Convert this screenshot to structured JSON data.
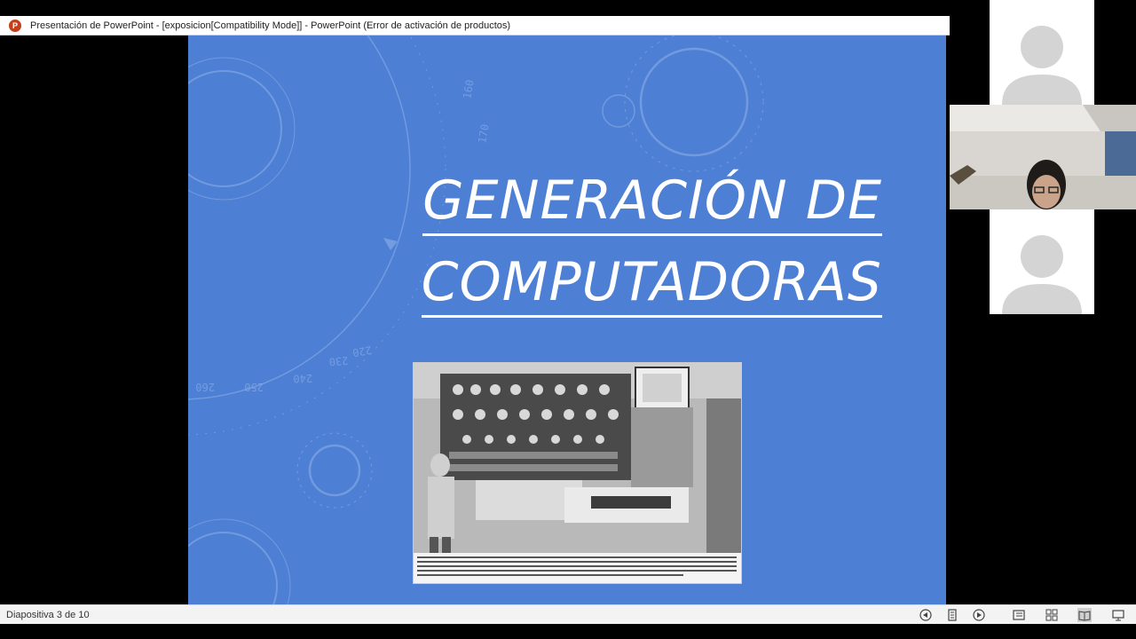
{
  "window": {
    "title": "Presentación de PowerPoint - [exposicion[Compatibility Mode]] - PowerPoint (Error de activación de productos)",
    "app_icon_letter": "P"
  },
  "slide": {
    "title_line1": "GENERACIÓN DE",
    "title_line2": "COMPUTADORAS",
    "background_color": "#4d7fd4",
    "dial_numbers": [
      "160",
      "170",
      "220",
      "230",
      "240",
      "250",
      "260"
    ]
  },
  "status": {
    "slide_counter": "Diapositiva 3 de 10"
  },
  "video_panel": {
    "participants": [
      {
        "type": "avatar"
      },
      {
        "type": "camera"
      },
      {
        "type": "avatar"
      }
    ]
  }
}
